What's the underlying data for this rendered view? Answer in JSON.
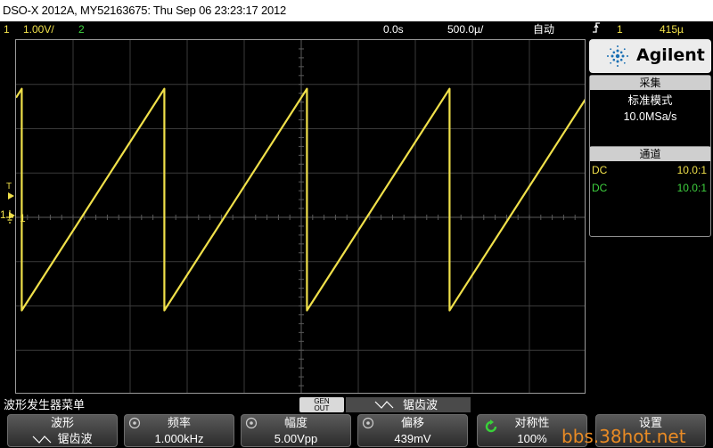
{
  "title_bar": {
    "text": "DSO-X 2012A, MY52163675: Thu Sep 06 23:23:17 2012"
  },
  "status_bar": {
    "ch1_number": "1",
    "ch1_scale": "1.00V/",
    "ch2_number": "2",
    "time_delay": "0.0s",
    "time_scale": "500.0µ/",
    "trigger_mode": "自动",
    "trigger_source": "1",
    "trigger_level": "415µ",
    "colors": {
      "ch1": "#f0e04a",
      "ch2": "#3fd23f"
    }
  },
  "scope": {
    "markers": {
      "trigger_marker": "T",
      "ch1_marker": "1",
      "ground_marker": "1"
    },
    "waveform": {
      "type": "sawtooth",
      "color": "#f0e04a",
      "cycles_visible": 5
    }
  },
  "side_panel": {
    "logo_text": "Agilent",
    "acquire": {
      "header": "采集",
      "mode": "标准模式",
      "sample_rate": "10.0MSa/s"
    },
    "channels": {
      "header": "通道",
      "rows": [
        {
          "coupling": "DC",
          "probe": "10.0:1",
          "color": "#f0e04a"
        },
        {
          "coupling": "DC",
          "probe": "10.0:1",
          "color": "#3fd23f"
        }
      ]
    }
  },
  "menu": {
    "title": "波形发生器菜单",
    "gen_out_line1": "GEN",
    "gen_out_line2": "OUT",
    "current_wave": "锯齿波"
  },
  "softkeys": [
    {
      "label": "波形",
      "value": "锯齿波",
      "icon": "sawtooth-wave-icon"
    },
    {
      "label": "频率",
      "value": "1.000kHz",
      "icon": "knob-icon"
    },
    {
      "label": "幅度",
      "value": "5.00Vpp",
      "icon": "knob-icon"
    },
    {
      "label": "偏移",
      "value": "439mV",
      "icon": "knob-icon"
    },
    {
      "label": "对称性",
      "value": "100%",
      "icon": "rotate-knob-icon"
    },
    {
      "label": "设置",
      "value": "",
      "icon": ""
    }
  ],
  "watermark": "bbs.38hot.net"
}
